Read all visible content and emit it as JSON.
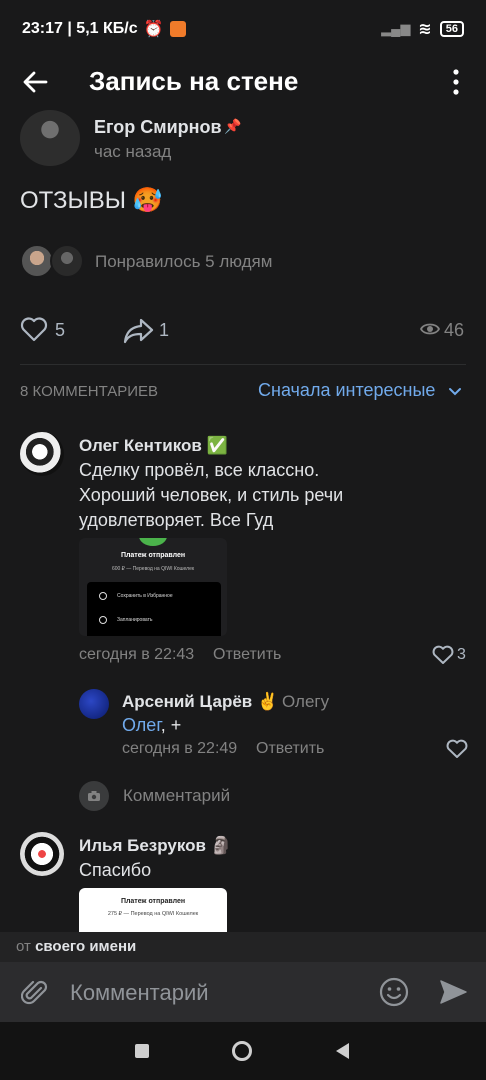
{
  "status_bar": {
    "left": "23:17 | 5,1 КБ/с",
    "battery": "56"
  },
  "header": {
    "title": "Запись на стене"
  },
  "post": {
    "author": "Егор Смирнов",
    "time": "час назад",
    "text": "ОТЗЫВЫ 🥵",
    "liked_text": "Понравилось 5 людям",
    "likes": "5",
    "shares": "1",
    "views": "46"
  },
  "comments_section": {
    "count_label": "8 КОММЕНТАРИЕВ",
    "sort_label": "Сначала интересные"
  },
  "comments": [
    {
      "author": "Олег Кентиков ✅",
      "text": "Сделку провёл, все классно. Хороший человек, и стиль речи удовлетворяет. Все Гуд",
      "time": "сегодня в 22:43",
      "reply": "Ответить",
      "likes": "3",
      "attachment": {
        "title": "Платеж отправлен",
        "subtitle": "600 ₽ — Перевод на QIWI Кошелек",
        "items": [
          "Сохранить в Избранное",
          "Запланировать"
        ]
      }
    },
    {
      "author": "Арсений Царёв ✌️",
      "reply_to": "Олегу",
      "mention": "Олег",
      "text_rest": ", +",
      "time": "сегодня в 22:49",
      "reply": "Ответить"
    },
    {
      "author": "Илья Безруков 🗿",
      "text": "Спасибо",
      "attachment": {
        "title": "Платеж отправлен",
        "subtitle": "275 ₽ — Перевод на QIWI Кошелек"
      }
    }
  ],
  "reply_box": {
    "placeholder": "Комментарий"
  },
  "from_bar": {
    "prefix": "от",
    "bold": "своего имени"
  },
  "input_bar": {
    "placeholder": "Комментарий"
  },
  "colors": {
    "background": "#19191a",
    "accent": "#71aaeb",
    "secondary_text": "#828282"
  }
}
